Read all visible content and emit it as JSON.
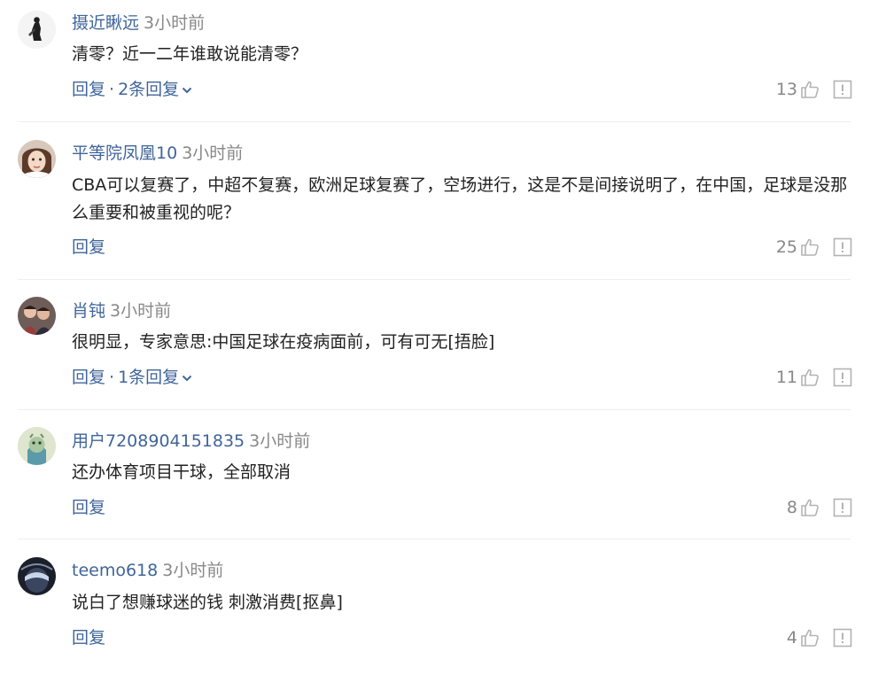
{
  "comments": [
    {
      "author": "摄近瞅远",
      "time": "3小时前",
      "text": "清零？近一二年谁敢说能清零？",
      "reply": "回复",
      "sep": "·",
      "replies": "2条回复",
      "likes": "13"
    },
    {
      "author": "平等院凤凰10",
      "time": "3小时前",
      "text": "CBA可以复赛了，中超不复赛，欧洲足球复赛了，空场进行，这是不是间接说明了，在中国，足球是没那么重要和被重视的呢？",
      "reply": "回复",
      "likes": "25"
    },
    {
      "author": "肖钝",
      "time": "3小时前",
      "text": "很明显，专家意思:中国足球在疫病面前，可有可无[捂脸]",
      "reply": "回复",
      "sep": "·",
      "replies": "1条回复",
      "likes": "11"
    },
    {
      "author": "用户7208904151835",
      "time": "3小时前",
      "text": "还办体育项目干球，全部取消",
      "reply": "回复",
      "likes": "8"
    },
    {
      "author": "teemo618",
      "time": "3小时前",
      "text": "说白了想赚球迷的钱 刺激消费[抠鼻]",
      "reply": "回复",
      "likes": "4"
    }
  ],
  "colors": {
    "link": "#406599",
    "muted": "#888888",
    "text": "#222222",
    "divider": "#eeeeee"
  },
  "icons": {
    "like": "thumbs-up-icon",
    "report": "report-icon",
    "expand": "chevron-down-icon"
  }
}
